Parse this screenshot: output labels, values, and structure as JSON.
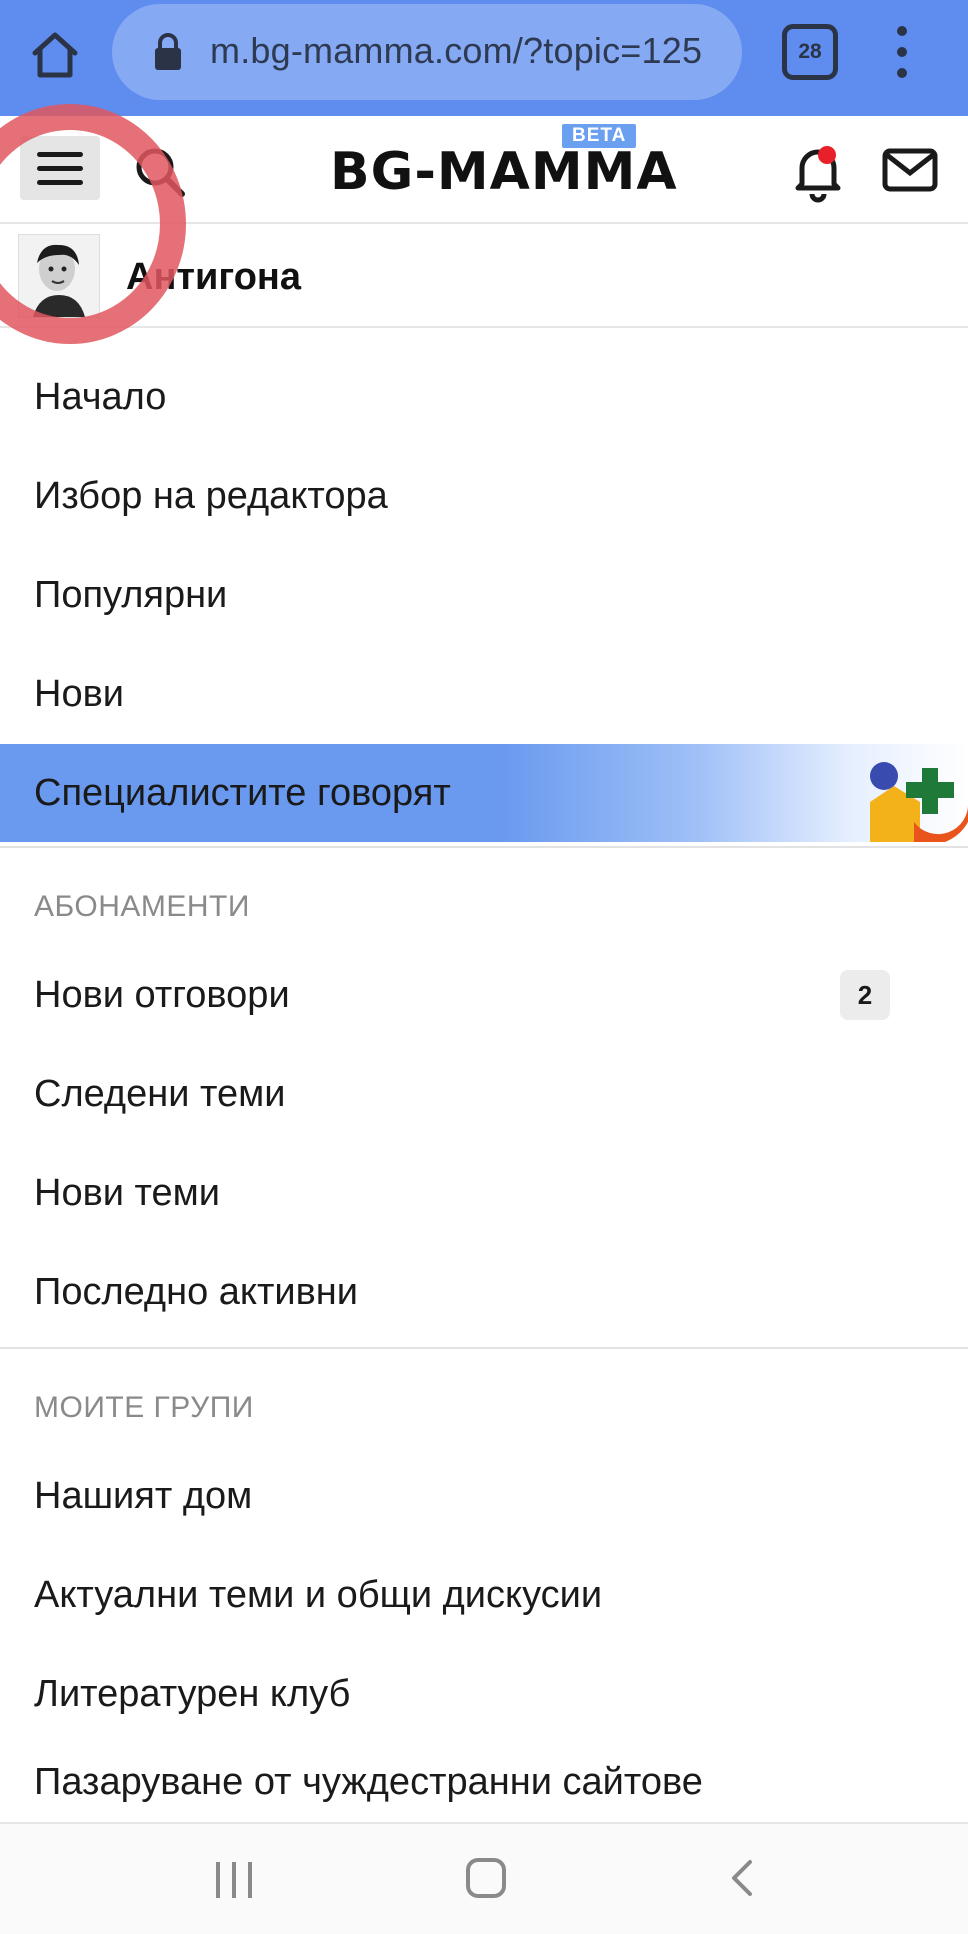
{
  "browser": {
    "url": "m.bg-mamma.com/?topic=125",
    "tab_count": "28"
  },
  "header": {
    "logo": "BG-MAMMA",
    "beta": "BETA"
  },
  "profile": {
    "name": "Антигона"
  },
  "menu": {
    "items": [
      {
        "label": "Начало"
      },
      {
        "label": "Избор на редактора"
      },
      {
        "label": "Популярни"
      },
      {
        "label": "Нови"
      }
    ],
    "featured": {
      "label": "Специалистите говорят"
    }
  },
  "subscriptions": {
    "title": "АБОНАМЕНТИ",
    "items": [
      {
        "label": "Нови отговори",
        "badge": "2"
      },
      {
        "label": "Следени теми"
      },
      {
        "label": "Нови теми"
      },
      {
        "label": "Последно активни"
      }
    ]
  },
  "groups": {
    "title": "МОИТЕ ГРУПИ",
    "items": [
      {
        "label": "Нашият дом"
      },
      {
        "label": "Актуални теми и общи дискусии"
      },
      {
        "label": "Литературен клуб"
      },
      {
        "label": "Пазаруване от чуждестранни сайтове"
      }
    ]
  },
  "colors": {
    "browser_bar": "#5f8def",
    "featured": "#6a9aef",
    "annotation": "#e0575f",
    "notification_dot": "#e8202a"
  },
  "icons": [
    "home-icon",
    "lock-icon",
    "tabs-icon",
    "more-icon",
    "menu-icon",
    "search-icon",
    "bell-icon",
    "mail-icon",
    "recent-apps-icon",
    "home-nav-icon",
    "back-icon"
  ]
}
